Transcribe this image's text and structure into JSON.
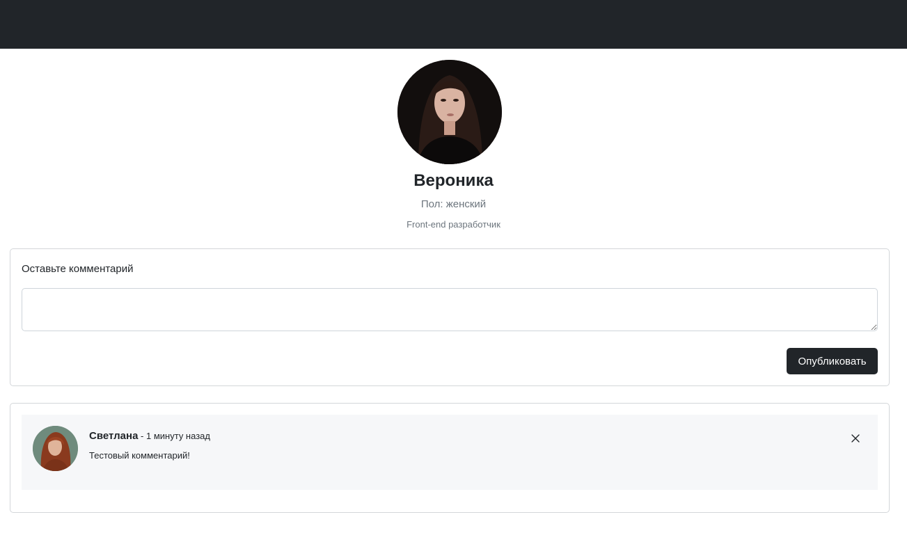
{
  "profile": {
    "name": "Вероника",
    "gender": "Пол: женский",
    "position": "Front-end разработчик"
  },
  "comment_form": {
    "label": "Оставьте комментарий",
    "value": "",
    "submit_label": "Опубликовать"
  },
  "comments": [
    {
      "author": "Светлана",
      "separator": " - ",
      "time": "1 минуту назад",
      "text": "Тестовый комментарий!"
    }
  ],
  "colors": {
    "navbar": "#212529",
    "button": "#212529",
    "muted_text": "#6c757d",
    "comment_bg": "#f6f7f9"
  }
}
